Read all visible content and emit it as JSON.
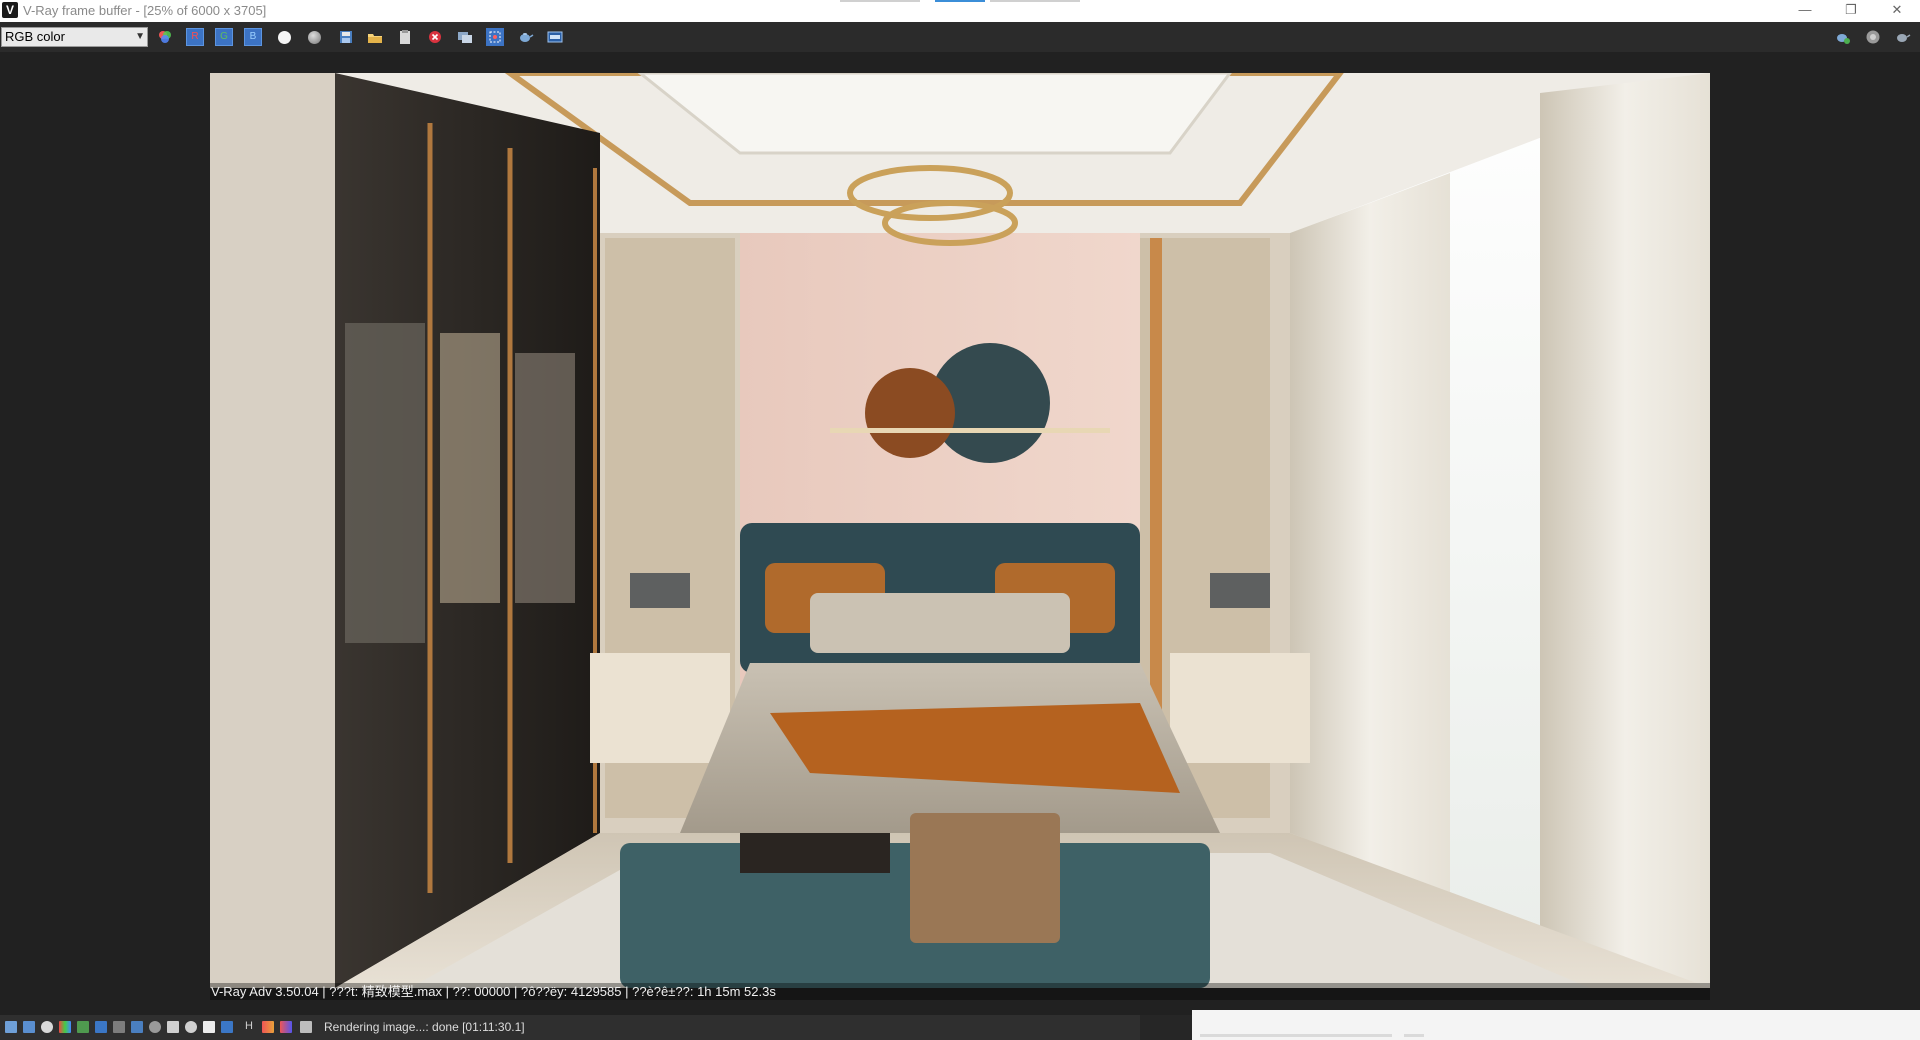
{
  "window": {
    "title": "V-Ray frame buffer - [25% of 6000 x 3705]",
    "app_icon": "V",
    "minimize": "—",
    "restore": "❐",
    "close": "✕"
  },
  "toolbar": {
    "channel": "RGB color",
    "channel_buttons": {
      "r": "R",
      "g": "G",
      "b": "B"
    }
  },
  "render_stamp": {
    "text": "V-Ray Adv 3.50.04 | ???t: 精致模型.max | ??: 00000 | ?ô??ëy: 4129585 | ??è?ê±??:  1h 15m 52.3s"
  },
  "statusbar": {
    "text": "Rendering image...: done [01:11:30.1]",
    "h_label": "H"
  },
  "colors": {
    "accent": "#3b8ed8",
    "toolbar_bg": "#2b2b2b",
    "background": "#212121"
  }
}
